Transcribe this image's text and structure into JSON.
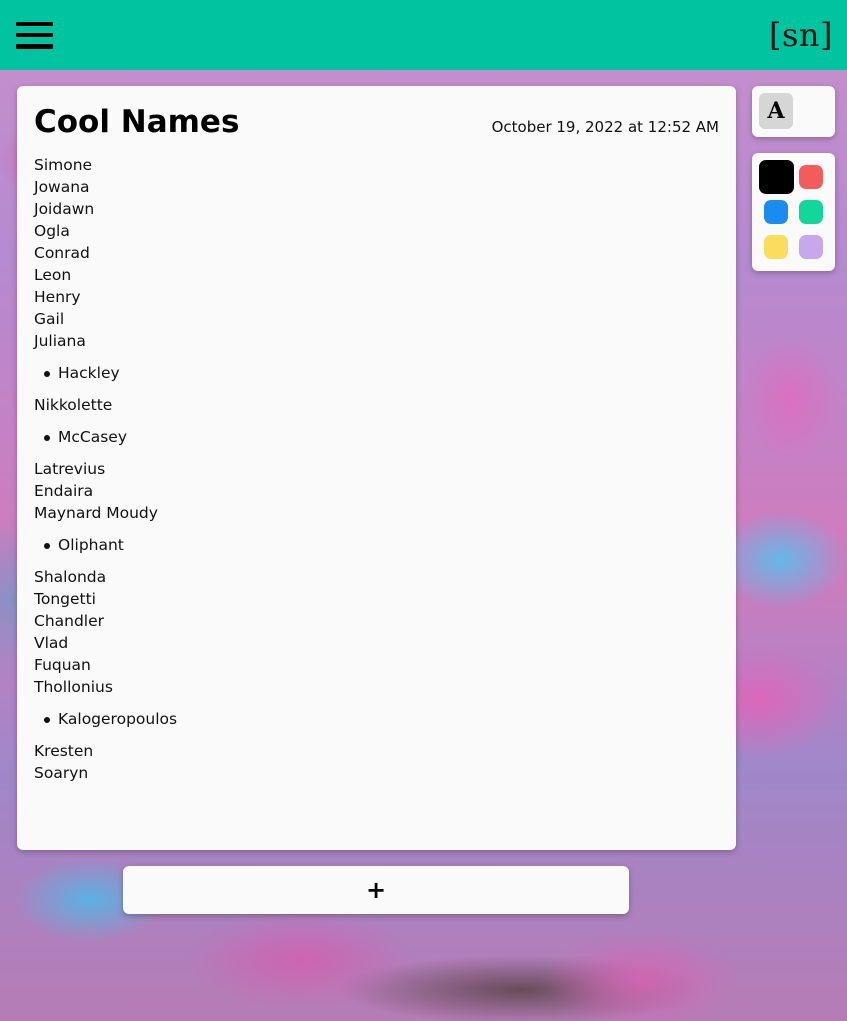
{
  "header": {
    "menu_icon": "hamburger-menu-icon",
    "logo": "[sn]",
    "background_color": "#00c4a0"
  },
  "note": {
    "title": "Cool Names",
    "date": "October 19, 2022 at 12:52 AM",
    "lines_group1": [
      "Simone",
      "Jowana",
      "Joidawn",
      "Ogla",
      "Conrad",
      "Leon",
      "Henry",
      "Gail",
      "Juliana"
    ],
    "bullet1": "Hackley",
    "lines_group2": [
      "Nikkolette"
    ],
    "bullet2": "McCasey",
    "lines_group3": [
      "Latrevius",
      "Endaira",
      "Maynard Moudy"
    ],
    "bullet3": "Oliphant",
    "lines_group4": [
      "Shalonda",
      "Tongetti",
      "Chandler",
      "Vlad",
      "Fuquan",
      "Thollonius"
    ],
    "bullet4": "Kalogeropoulos",
    "lines_group5": [
      "Kresten",
      "Soaryn"
    ]
  },
  "font_panel": {
    "label": "A"
  },
  "color_panel": {
    "swatches": [
      {
        "name": "black",
        "color": "#000000",
        "selected": true
      },
      {
        "name": "red",
        "color": "#f45b5b"
      },
      {
        "name": "blue",
        "color": "#1a8cf0"
      },
      {
        "name": "green",
        "color": "#13d69c"
      },
      {
        "name": "yellow",
        "color": "#fcdc5c"
      },
      {
        "name": "purple",
        "color": "#c8a8ec"
      }
    ]
  },
  "add_button": {
    "label": "+"
  }
}
